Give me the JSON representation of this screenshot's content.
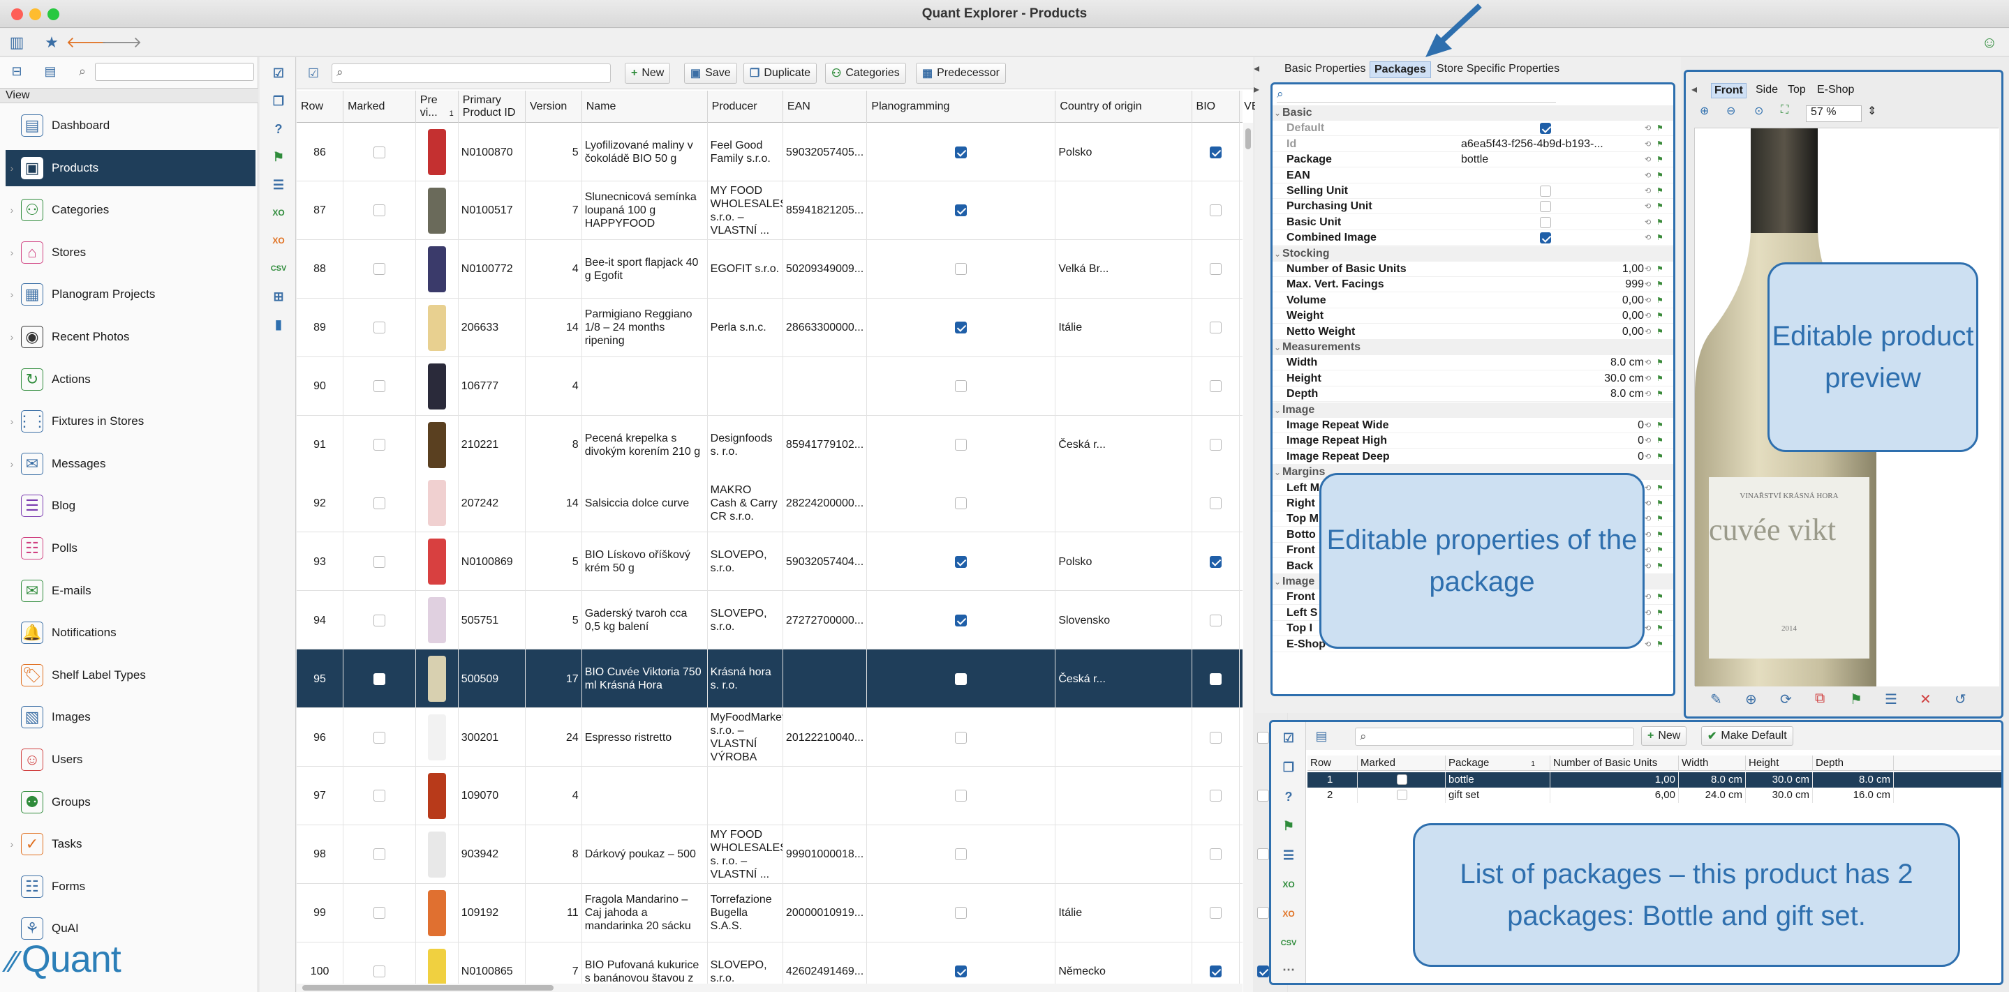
{
  "window": {
    "title": "Quant Explorer - Products"
  },
  "sidebar": {
    "view_label": "View",
    "items": [
      {
        "label": "Dashboard",
        "icon": "dashboard-icon",
        "color": "#3a6ea5"
      },
      {
        "label": "Products",
        "icon": "product-icon",
        "color": "#3a6ea5",
        "selected": true
      },
      {
        "label": "Categories",
        "icon": "categories-icon",
        "color": "#2e8b3a"
      },
      {
        "label": "Stores",
        "icon": "store-icon",
        "color": "#d04080"
      },
      {
        "label": "Planogram Projects",
        "icon": "planogram-icon",
        "color": "#3a6ea5"
      },
      {
        "label": "Recent Photos",
        "icon": "camera-icon",
        "color": "#333333"
      },
      {
        "label": "Actions",
        "icon": "actions-icon",
        "color": "#2e8b3a"
      },
      {
        "label": "Fixtures in Stores",
        "icon": "fixtures-icon",
        "color": "#3a6ea5"
      },
      {
        "label": "Messages",
        "icon": "messages-icon",
        "color": "#3a6ea5"
      },
      {
        "label": "Blog",
        "icon": "blog-icon",
        "color": "#7a3ab0"
      },
      {
        "label": "Polls",
        "icon": "polls-icon",
        "color": "#d04080"
      },
      {
        "label": "E-mails",
        "icon": "email-icon",
        "color": "#2e8b3a"
      },
      {
        "label": "Notifications",
        "icon": "notifications-icon",
        "color": "#3a6ea5"
      },
      {
        "label": "Shelf Label Types",
        "icon": "shelf-label-icon",
        "color": "#e07020"
      },
      {
        "label": "Images",
        "icon": "images-icon",
        "color": "#3a6ea5"
      },
      {
        "label": "Users",
        "icon": "users-icon",
        "color": "#d04040"
      },
      {
        "label": "Groups",
        "icon": "groups-icon",
        "color": "#2e8b3a"
      },
      {
        "label": "Tasks",
        "icon": "tasks-icon",
        "color": "#e07020"
      },
      {
        "label": "Forms",
        "icon": "forms-icon",
        "color": "#3a6ea5"
      },
      {
        "label": "QuAI",
        "icon": "quai-icon",
        "color": "#3a6ea5"
      }
    ],
    "logo_text": "Quant"
  },
  "toolbar": {
    "new_label": "New",
    "save_label": "Save",
    "duplicate_label": "Duplicate",
    "categories_label": "Categories",
    "predecessor_label": "Predecessor"
  },
  "table": {
    "columns": [
      "Row",
      "Marked",
      "Pre vi...",
      "Primary Product ID",
      "Version",
      "Name",
      "Producer",
      "EAN",
      "Planogramming",
      "Country of origin",
      "BIO",
      "VEGE"
    ],
    "sort_indicator": "1",
    "rows": [
      {
        "row": "86",
        "marked": false,
        "id": "N0100870",
        "version": "5",
        "name": "Lyofilizované maliny v čokoládě BIO 50 g",
        "producer": "Feel Good Family s.r.o.",
        "ean": "59032057405...",
        "plano": true,
        "country": "Polsko",
        "bio": true,
        "vege": true,
        "thumb": "#c43030"
      },
      {
        "row": "87",
        "marked": false,
        "id": "N0100517",
        "version": "7",
        "name": "Slunecnicová semínka loupaná 100 g HAPPYFOOD",
        "producer": "MY FOOD WHOLESALES, s.r.o. – VLASTNÍ ...",
        "ean": "85941821205...",
        "plano": true,
        "country": "",
        "bio": false,
        "vege": true,
        "thumb": "#6a6a5a"
      },
      {
        "row": "88",
        "marked": false,
        "id": "N0100772",
        "version": "4",
        "name": "Bee-it sport flapjack 40 g Egofit",
        "producer": "EGOFIT s.r.o.",
        "ean": "50209349009...",
        "plano": false,
        "country": "Velká Br...",
        "bio": false,
        "vege": true,
        "thumb": "#3a3a6a"
      },
      {
        "row": "89",
        "marked": false,
        "id": "206633",
        "version": "14",
        "name": "Parmigiano Reggiano 1/8 – 24 months ripening",
        "producer": "Perla s.n.c.",
        "ean": "28663300000...",
        "plano": true,
        "country": "Itálie",
        "bio": false,
        "vege": false,
        "thumb": "#e8d090"
      },
      {
        "row": "90",
        "marked": false,
        "id": "106777",
        "version": "4",
        "name": "",
        "producer": "",
        "ean": "",
        "plano": false,
        "country": "",
        "bio": false,
        "vege": false,
        "thumb": "#2a2a3a"
      },
      {
        "row": "91",
        "marked": false,
        "id": "210221",
        "version": "8",
        "name": "Pecená krepelka s divokým korením 210 g",
        "producer": "Designfoods s. r.o.",
        "ean": "85941779102...",
        "plano": false,
        "country": "Česká r...",
        "bio": false,
        "vege": false,
        "thumb": "#5a4020"
      },
      {
        "row": "92",
        "marked": false,
        "id": "207242",
        "version": "14",
        "name": "Salsiccia dolce curve",
        "producer": "MAKRO Cash & Carry CR s.r.o.",
        "ean": "28224200000...",
        "plano": false,
        "country": "",
        "bio": false,
        "vege": false,
        "thumb": "#f0d0d0"
      },
      {
        "row": "93",
        "marked": false,
        "id": "N0100869",
        "version": "5",
        "name": "BIO Lískovo oříškový krém 50 g",
        "producer": "SLOVEPO, s.r.o.",
        "ean": "59032057404...",
        "plano": true,
        "country": "Polsko",
        "bio": true,
        "vege": true,
        "thumb": "#d84040"
      },
      {
        "row": "94",
        "marked": false,
        "id": "505751",
        "version": "5",
        "name": "Gaderský tvaroh cca 0,5 kg balení",
        "producer": "SLOVEPO, s.r.o.",
        "ean": "27272700000...",
        "plano": true,
        "country": "Slovensko",
        "bio": false,
        "vege": false,
        "thumb": "#e0d0e0"
      },
      {
        "row": "95",
        "marked": false,
        "id": "500509",
        "version": "17",
        "name": "BIO Cuvée Viktoria 750 ml Krásná Hora",
        "producer": "Krásná hora s. r.o.",
        "ean": "",
        "plano": true,
        "country": "Česká r...",
        "bio": true,
        "vege": false,
        "thumb": "#d8d0b0",
        "selected": true
      },
      {
        "row": "96",
        "marked": false,
        "id": "300201",
        "version": "24",
        "name": "Espresso ristretto",
        "producer": "MyFoodMarket, s.r.o. – VLASTNÍ VÝROBA",
        "ean": "20122210040...",
        "plano": false,
        "country": "",
        "bio": false,
        "vege": false,
        "thumb": "#f2f2f2"
      },
      {
        "row": "97",
        "marked": false,
        "id": "109070",
        "version": "4",
        "name": "",
        "producer": "",
        "ean": "",
        "plano": false,
        "country": "",
        "bio": false,
        "vege": false,
        "thumb": "#b83a1a"
      },
      {
        "row": "98",
        "marked": false,
        "id": "903942",
        "version": "8",
        "name": "Dárkový poukaz – 500",
        "producer": "MY FOOD WHOLESALES s. r.o. – VLASTNÍ ...",
        "ean": "99901000018...",
        "plano": false,
        "country": "",
        "bio": false,
        "vege": false,
        "thumb": "#e8e8e8"
      },
      {
        "row": "99",
        "marked": false,
        "id": "109192",
        "version": "11",
        "name": "Fragola Mandarino – Caj jahoda a mandarinka 20 sácku",
        "producer": "Torrefazione Bugella S.A.S.",
        "ean": "20000010919...",
        "plano": false,
        "country": "Itálie",
        "bio": false,
        "vege": false,
        "thumb": "#e07030"
      },
      {
        "row": "100",
        "marked": false,
        "id": "N0100865",
        "version": "7",
        "name": "BIO Pufovaná kukurice s banánovou štavou z",
        "producer": "SLOVEPO, s.r.o.",
        "ean": "42602491469...",
        "plano": true,
        "country": "Německo",
        "bio": true,
        "vege": true,
        "thumb": "#f0d040"
      }
    ]
  },
  "properties": {
    "tabs": [
      "Basic Properties",
      "Packages",
      "Store Specific Properties"
    ],
    "active_tab": "Packages",
    "rows": [
      {
        "type": "group",
        "key": "Basic"
      },
      {
        "key": "Default",
        "check": true,
        "gray": true
      },
      {
        "key": "Id",
        "value": "a6ea5f43-f256-4b9d-b193-...",
        "gray": true,
        "left": true
      },
      {
        "key": "Package",
        "value": "bottle",
        "left": true
      },
      {
        "key": "EAN",
        "value": ""
      },
      {
        "key": "Selling Unit",
        "check": false
      },
      {
        "key": "Purchasing Unit",
        "check": false
      },
      {
        "key": "Basic Unit",
        "check": false
      },
      {
        "key": "Combined Image",
        "check": true
      },
      {
        "type": "group",
        "key": "Stocking"
      },
      {
        "key": "Number of Basic Units",
        "value": "1,00"
      },
      {
        "key": "Max. Vert. Facings",
        "value": "999"
      },
      {
        "key": "Volume",
        "value": "0,00"
      },
      {
        "key": "Weight",
        "value": "0,00"
      },
      {
        "key": "Netto Weight",
        "value": "0,00"
      },
      {
        "type": "group",
        "key": "Measurements"
      },
      {
        "key": "Width",
        "value": "8.0 cm"
      },
      {
        "key": "Height",
        "value": "30.0 cm"
      },
      {
        "key": "Depth",
        "value": "8.0 cm"
      },
      {
        "type": "group",
        "key": "Image"
      },
      {
        "key": "Image Repeat Wide",
        "value": "0"
      },
      {
        "key": "Image Repeat High",
        "value": "0"
      },
      {
        "key": "Image Repeat Deep",
        "value": "0"
      },
      {
        "type": "group",
        "key": "Margins"
      },
      {
        "key": "Left M",
        "value": ""
      },
      {
        "key": "Right",
        "value": ""
      },
      {
        "key": "Top M",
        "value": ""
      },
      {
        "key": "Botto",
        "value": ""
      },
      {
        "key": "Front",
        "value": ""
      },
      {
        "key": "Back",
        "value": ""
      },
      {
        "type": "group",
        "key": "Image"
      },
      {
        "key": "Front",
        "value": ""
      },
      {
        "key": "Left S",
        "value": ""
      },
      {
        "key": "Top I",
        "value": ""
      },
      {
        "key": "E-Shop",
        "value": ""
      }
    ]
  },
  "preview": {
    "tabs": [
      "Front",
      "Side",
      "Top",
      "E-Shop"
    ],
    "active_tab": "Front",
    "zoom": "57 %",
    "label_brand": "VINAŘSTVÍ KRÁSNÁ HORA",
    "label_name": "cuvée vikt",
    "label_year": "2014"
  },
  "packages": {
    "new_label": "New",
    "make_default_label": "Make Default",
    "columns": [
      "Row",
      "Marked",
      "Package",
      "Number of Basic Units",
      "Width",
      "Height",
      "Depth"
    ],
    "sort_indicator": "1",
    "rows": [
      {
        "row": "1",
        "package": "bottle",
        "units": "1,00",
        "width": "8.0 cm",
        "height": "30.0 cm",
        "depth": "8.0 cm",
        "selected": true
      },
      {
        "row": "2",
        "package": "gift set",
        "units": "6,00",
        "width": "24.0 cm",
        "height": "30.0 cm",
        "depth": "16.0 cm"
      }
    ]
  },
  "callouts": {
    "preview": "Editable product preview",
    "properties": "Editable properties of the package",
    "packages": "List of packages – this product has 2 packages: Bottle and gift set."
  }
}
